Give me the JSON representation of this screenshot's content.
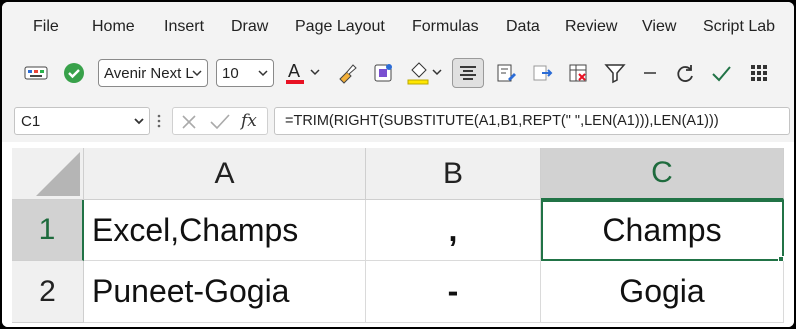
{
  "menu": {
    "tabs": [
      {
        "label": "File"
      },
      {
        "label": "Home"
      },
      {
        "label": "Insert"
      },
      {
        "label": "Draw"
      },
      {
        "label": "Page Layout"
      },
      {
        "label": "Formulas"
      },
      {
        "label": "Data"
      },
      {
        "label": "Review"
      },
      {
        "label": "View"
      },
      {
        "label": "Script Lab"
      }
    ]
  },
  "toolbar": {
    "font_name": "Avenir Next L",
    "font_size": "10",
    "font_color": "#e81123",
    "fill_color": "#ffe600",
    "accent_color": "#217346"
  },
  "formula_bar": {
    "name_box": "C1",
    "fx_label": "fx",
    "formula": "=TRIM(RIGHT(SUBSTITUTE(A1,B1,REPT(\" \",LEN(A1))),LEN(A1)))"
  },
  "sheet": {
    "columns": [
      "A",
      "B",
      "C"
    ],
    "active_column": "C",
    "rows": [
      {
        "number": "1",
        "a": "Excel,Champs",
        "b": ",",
        "c": "Champs"
      },
      {
        "number": "2",
        "a": "Puneet-Gogia",
        "b": "-",
        "c": "Gogia"
      }
    ],
    "selected_cell": "C1"
  }
}
